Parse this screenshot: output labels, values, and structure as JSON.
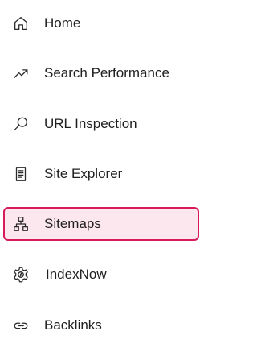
{
  "nav": {
    "items": [
      {
        "label": "Home",
        "icon": "home-icon",
        "active": false
      },
      {
        "label": "Search Performance",
        "icon": "trend-up-icon",
        "active": false
      },
      {
        "label": "URL Inspection",
        "icon": "search-icon",
        "active": false
      },
      {
        "label": "Site Explorer",
        "icon": "document-list-icon",
        "active": false
      },
      {
        "label": "Sitemaps",
        "icon": "sitemap-icon",
        "active": true
      },
      {
        "label": "IndexNow",
        "icon": "gear-icon",
        "active": false
      },
      {
        "label": "Backlinks",
        "icon": "link-icon",
        "active": false
      }
    ]
  },
  "colors": {
    "active_background": "#fde7ef",
    "active_border": "#d61b5a",
    "text": "#1f1f1f",
    "icon": "#2a2a2a"
  }
}
